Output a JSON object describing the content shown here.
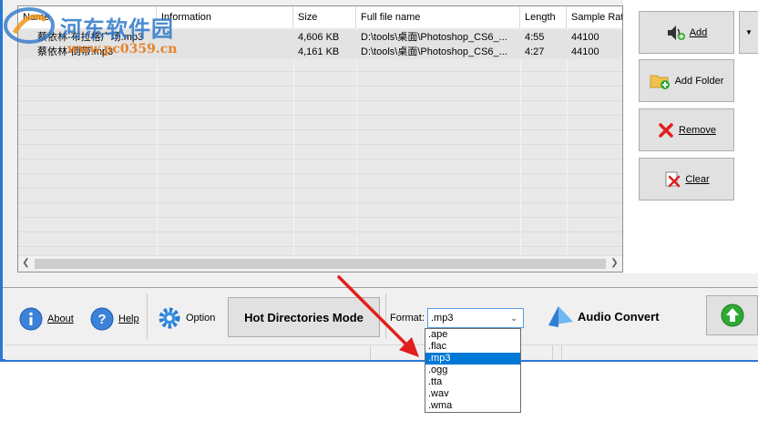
{
  "columns": [
    "Name",
    "Information",
    "Size",
    "Full file name",
    "Length",
    "Sample Rate"
  ],
  "rows": [
    {
      "name": "蔡依林-布拉格广场.mp3",
      "info": "",
      "size": "4,606 KB",
      "path": "D:\\tools\\桌面\\Photoshop_CS6_...",
      "length": "4:55",
      "rate": "44100"
    },
    {
      "name": "蔡依林-倒带.mp3",
      "info": "",
      "size": "4,161 KB",
      "path": "D:\\tools\\桌面\\Photoshop_CS6_...",
      "length": "4:27",
      "rate": "44100"
    }
  ],
  "side_buttons": {
    "add": "Add",
    "add_folder": "Add Folder",
    "remove": "Remove",
    "clear": "Clear"
  },
  "bottom": {
    "about": "About",
    "help": "Help",
    "option": "Option",
    "hot_directories": "Hot Directories Mode",
    "format_label": "Format:",
    "format_value": ".mp3",
    "audio_convert": "Audio Convert"
  },
  "format_options": [
    ".ape",
    ".flac",
    ".mp3",
    ".ogg",
    ".tta",
    ".wav",
    ".wma"
  ],
  "selected_format": ".mp3",
  "watermark": {
    "line1": "河东软件园",
    "line2": "www.pc0359.cn"
  },
  "colors": {
    "accent": "#0078d7",
    "window_border": "#2b78d4",
    "arrow": "#e0201c",
    "convert_green": "#2eaa32"
  }
}
